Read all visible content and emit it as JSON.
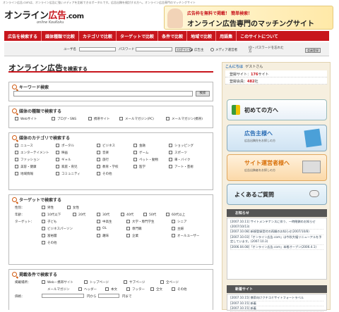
{
  "topline": "オンライン広告.comは、オンライン広告に強いメディアを比較できるポータルです。広告出稿を検討する方へ。オンライン広告専門のマッチングサイト",
  "logo": {
    "main": "オンライン",
    "red": "広告",
    "dot": ".com",
    "sub": "online KouKoku"
  },
  "banner": {
    "line1": "広告枠を無料で掲載！ 簡単検索！",
    "line2": "オンライン広告専門のマッチングサイト"
  },
  "nav": [
    "広告を検索する",
    "媒体種類で比較",
    "カテゴリで比較",
    "ターゲットで比較",
    "条件で比較",
    "地域で比較",
    "用語集",
    "このサイトについて"
  ],
  "login": {
    "user_label": "ユーザ名",
    "pass_label": "パスワード",
    "login_btn": "ログイン",
    "radio1": "広告主",
    "radio2": "メディア運営者",
    "forgot": "ID・パスワードを忘れた方",
    "register_btn": "会員登録"
  },
  "main": {
    "title": "オンライン広告",
    "title_suffix": "を検索する",
    "keyword": {
      "heading": "キーワード検索",
      "button": "検索"
    },
    "media_type": {
      "heading": "媒体の種類で検索する",
      "options": [
        "Webサイト",
        "ブログ・SNS",
        "携帯サイト",
        "メールマガジン(PC)",
        "メールマガジン(携帯)"
      ]
    },
    "category": {
      "heading": "媒体のカテゴリで検索する",
      "rows": [
        [
          "ニュース",
          "ポータル",
          "ビジネス",
          "金融",
          "ショッピング"
        ],
        [
          "エンターテイメント",
          "映画",
          "音楽",
          "ゲーム",
          "スポーツ"
        ],
        [
          "ファッション",
          "ギャル",
          "旅行",
          "ペット・動物",
          "車・バイク"
        ],
        [
          "美容・健康",
          "家庭・育児",
          "教育・学校",
          "医学",
          "アート・芸術"
        ],
        [
          "地域情報",
          "コミュニティ",
          "その他"
        ]
      ]
    },
    "target": {
      "heading": "ターゲットで検索する",
      "gender_label": "性別：",
      "gender": [
        "男性",
        "女性"
      ],
      "age_label": "年齢：",
      "age": [
        "10代以下",
        "20代",
        "30代",
        "40代",
        "50代",
        "60代以上"
      ],
      "target_label": "ターゲット：",
      "targets_row1": [
        "子ども",
        "中高生",
        "大学・専門学生",
        "シニア"
      ],
      "targets_row2": [
        "ビジネスパーソン",
        "OL",
        "専門職",
        "主婦"
      ],
      "targets_row3": [
        "富裕層",
        "趣味",
        "企業",
        "オールユーザー"
      ],
      "targets_row4": [
        "その他"
      ]
    },
    "conditions": {
      "heading": "掲載条件で検索する",
      "pos_label": "掲載場所：",
      "pos_row1": [
        "Web・携帯サイト",
        "トップページ",
        "サブページ",
        "全ページ"
      ],
      "pos_row2": [
        "メールマガジン",
        "ヘッダー",
        "本文",
        "フッター",
        "全文",
        "その他"
      ],
      "price_label": "価格：",
      "price_from": "円から",
      "price_to": "円まで"
    }
  },
  "sidebar": {
    "welcome_prefix": "こんにちは",
    "welcome_user": "ゲストさん",
    "stats": [
      {
        "label": "登録サイト：",
        "num": "176",
        "unit": "サイト"
      },
      {
        "label": "登録会員：",
        "num": "482",
        "unit": "社"
      }
    ],
    "btn_first": "初めての方へ",
    "btn_advertiser": "広告主様へ",
    "btn_advertiser_sub": "広告出稿先をお探しの方",
    "btn_site": "サイト運営者様へ",
    "btn_site_sub": "広告出稿者をお探しの方",
    "btn_faq": "よくあるご質問",
    "news_heading": "お知らせ",
    "news": [
      "[2007.10.11] サイトメンテナンスに伴う、一時閉鎖のお知らせ(2007/10/13)",
      "[2007.10.08] 新規登録受付の再開のお知らせ(2007/10/8)",
      "[2007.10.03]「オンライン広告.com」は今秋大幅リニューアルを予定しています。(2007.10.3)",
      "[2006.04.08]「オンライン広告.com」本格オープン(2006.4.1)"
    ],
    "new_heading": "新着サイト",
    "new_sites": [
      "[2007.10.15] 携帯向けクチコミサイトフォートラベル",
      "[2007.10.15] 新着",
      "[2007.10.15] 新着"
    ]
  }
}
